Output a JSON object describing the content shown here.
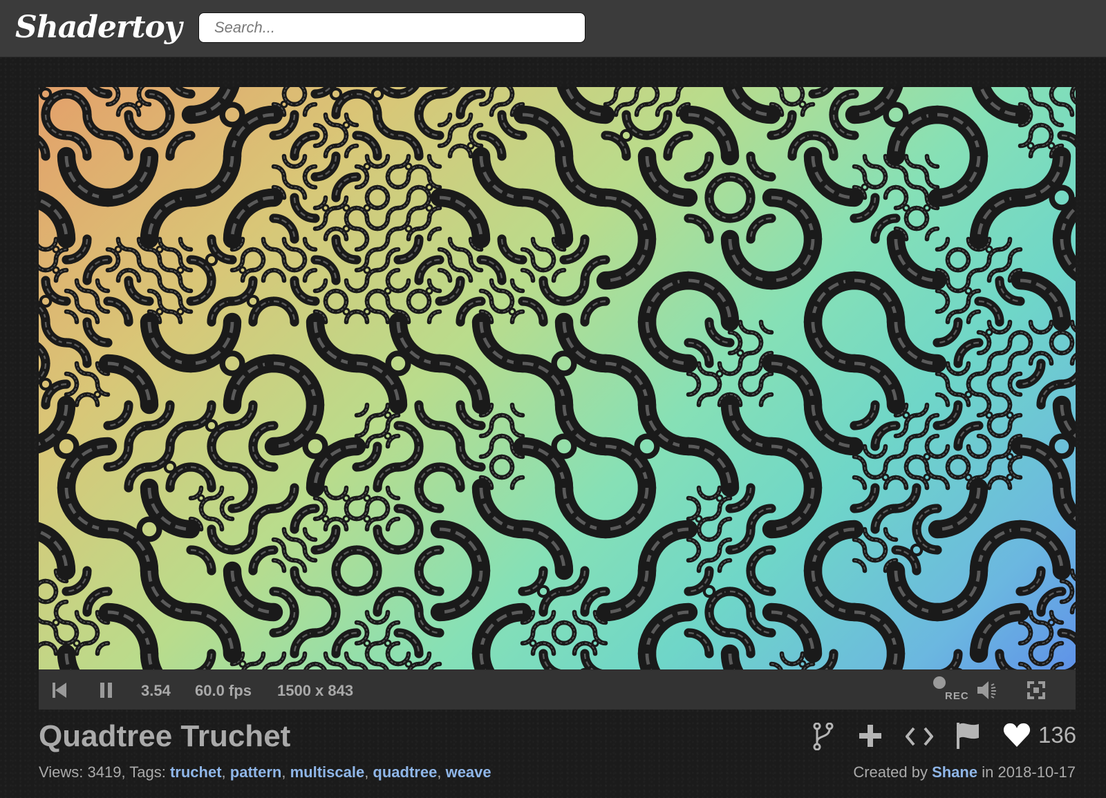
{
  "header": {
    "logo": "Shadertoy",
    "search_placeholder": "Search..."
  },
  "player": {
    "time": "3.54",
    "fps": "60.0 fps",
    "resolution": "1500 x 843",
    "rec_label": "REC"
  },
  "shader": {
    "title": "Quadtree Truchet",
    "views_label": "Views: 3419, Tags: ",
    "tags": [
      "truchet",
      "pattern",
      "multiscale",
      "quadtree",
      "weave"
    ],
    "likes": "136",
    "created_prefix": "Created by ",
    "author": "Shane",
    "date_prefix": " in ",
    "date": "2018-10-17"
  },
  "icons": {
    "restart": "skip-back-icon",
    "pause": "pause-icon",
    "record": "record-icon",
    "volume": "volume-icon",
    "fullscreen": "fullscreen-icon",
    "fork": "fork-icon",
    "add": "plus-icon",
    "embed": "code-icon",
    "report": "flag-icon",
    "like": "heart-icon"
  },
  "colors": {
    "link": "#8fb6e8",
    "header_bg": "#3b3b3b",
    "controls_bg": "#333333"
  }
}
